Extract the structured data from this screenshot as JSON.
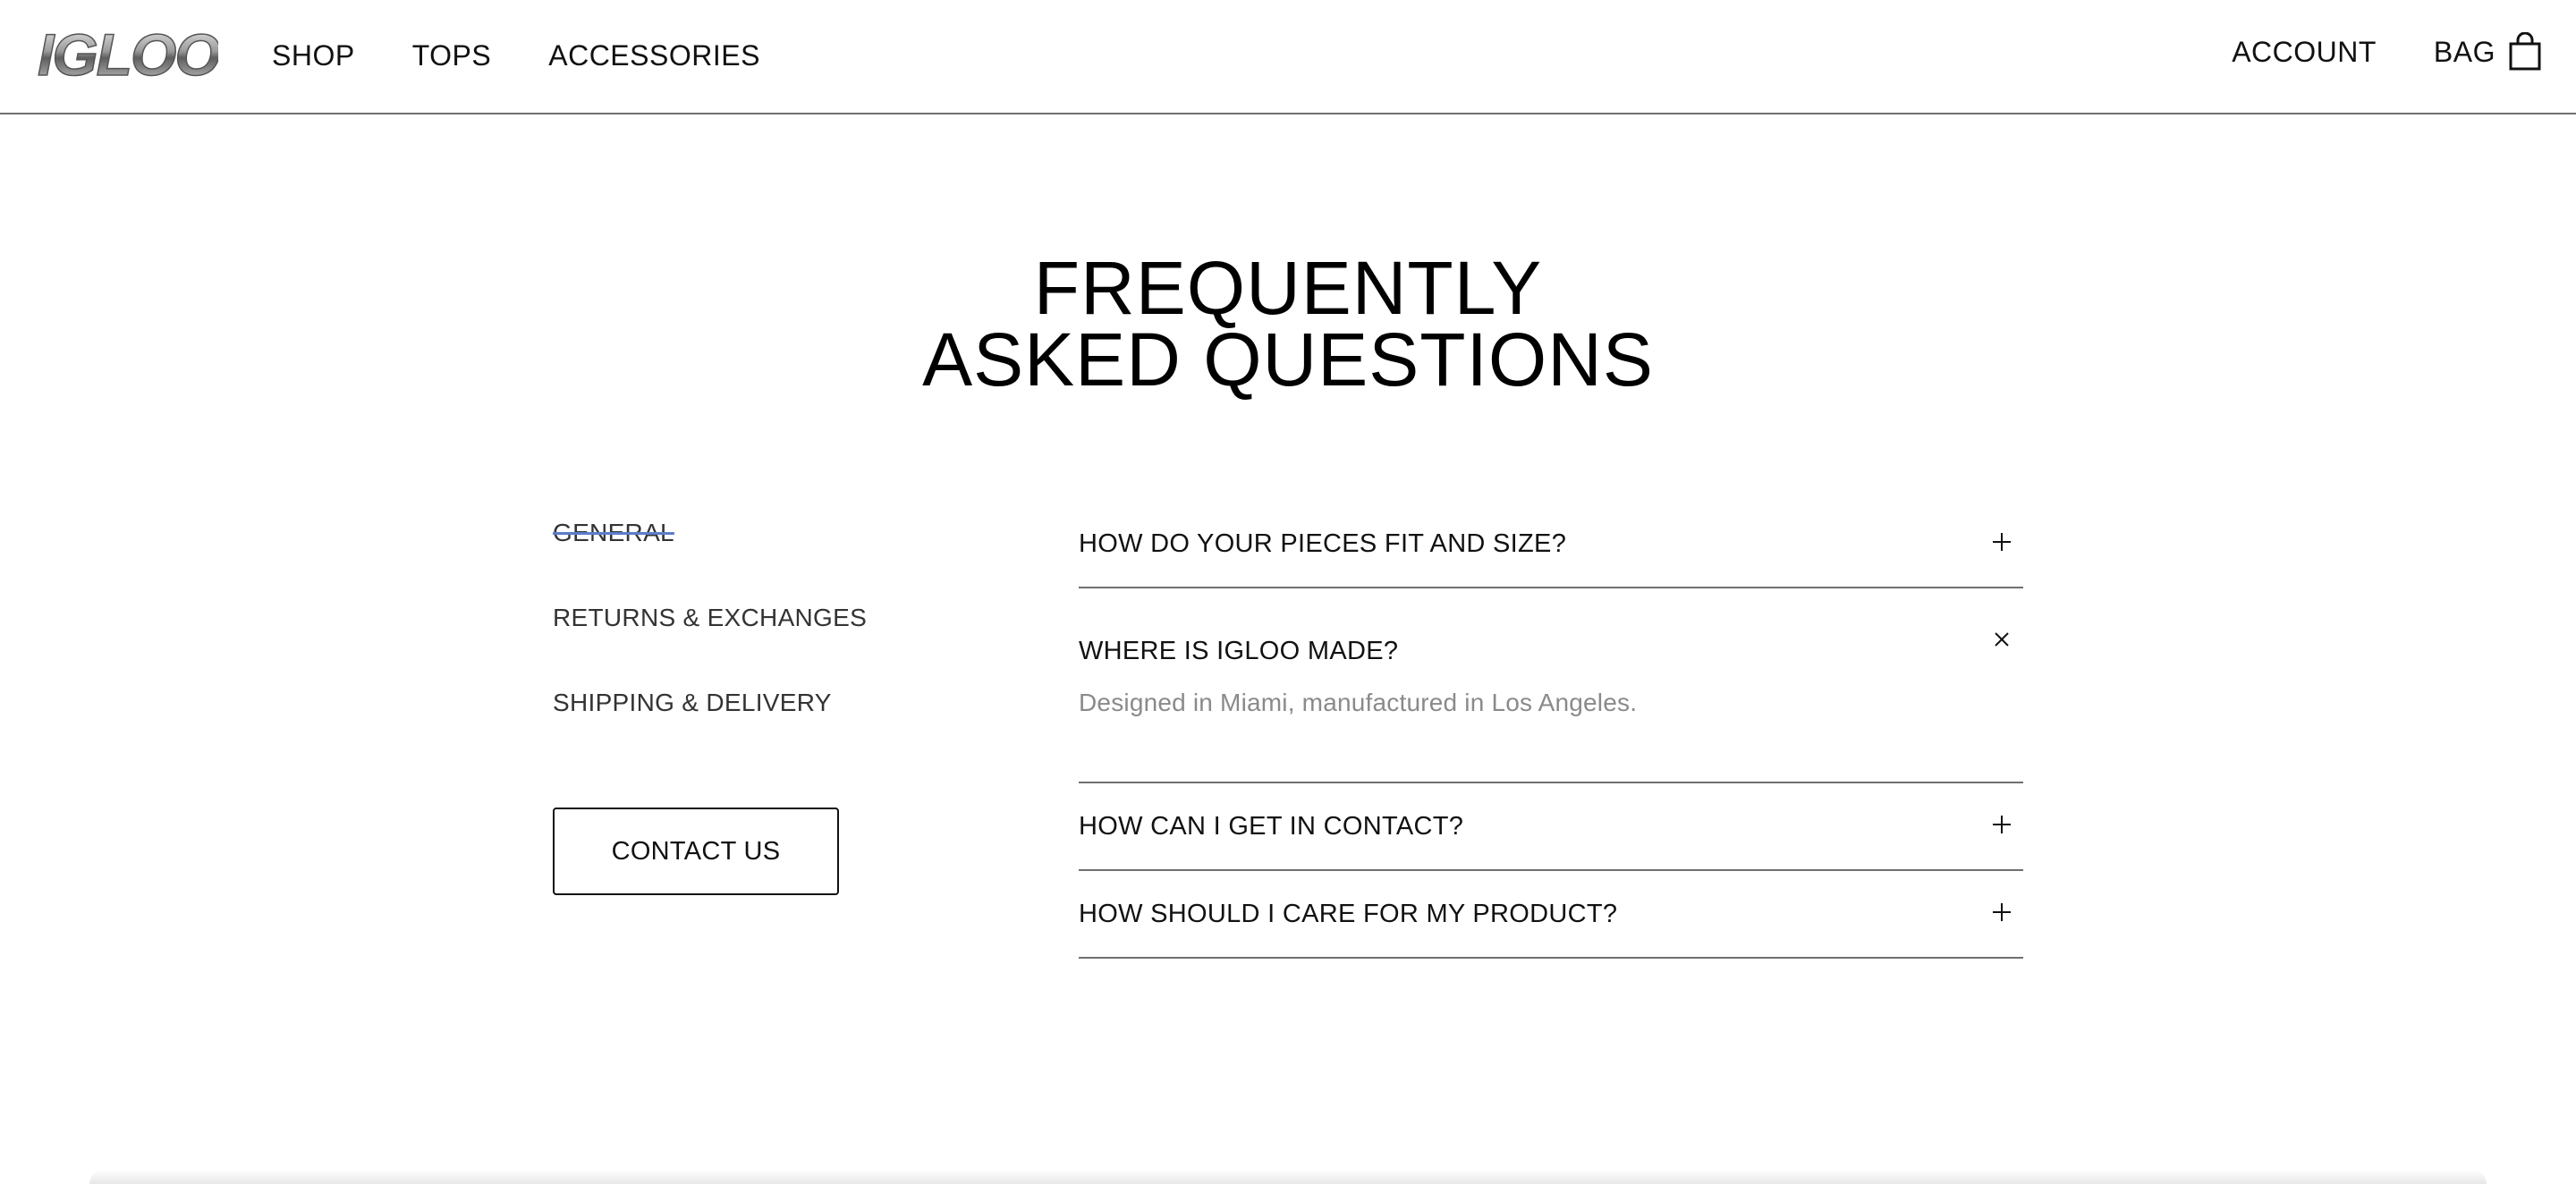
{
  "brand": {
    "logo_text": "IGLOO"
  },
  "header": {
    "nav_left": [
      {
        "label": "SHOP"
      },
      {
        "label": "TOPS"
      },
      {
        "label": "ACCESSORIES"
      }
    ],
    "account_label": "ACCOUNT",
    "bag_label": "BAG",
    "bag_icon": "shopping-bag-icon"
  },
  "page": {
    "title_line1": "FREQUENTLY",
    "title_line2": "ASKED QUESTIONS"
  },
  "categories": {
    "items": [
      {
        "label": "GENERAL",
        "active": true
      },
      {
        "label": "RETURNS & EXCHANGES",
        "active": false
      },
      {
        "label": "SHIPPING & DELIVERY",
        "active": false
      }
    ],
    "contact_label": "CONTACT US"
  },
  "faq": {
    "items": [
      {
        "question": "HOW DO YOUR PIECES FIT AND SIZE?",
        "open": false,
        "toggle_icon": "plus-icon"
      },
      {
        "question": "WHERE IS IGLOO MADE?",
        "open": true,
        "toggle_icon": "close-icon",
        "answer": "Designed in Miami, manufactured in Los Angeles."
      },
      {
        "question": "HOW CAN I GET IN CONTACT?",
        "open": false,
        "toggle_icon": "plus-icon"
      },
      {
        "question": "HOW SHOULD I CARE FOR MY PRODUCT?",
        "open": false,
        "toggle_icon": "plus-icon"
      }
    ]
  },
  "colors": {
    "text": "#111111",
    "muted_answer": "#8a8a8a",
    "divider": "#6f6f6f",
    "active_strike": "#5b7ec8"
  }
}
